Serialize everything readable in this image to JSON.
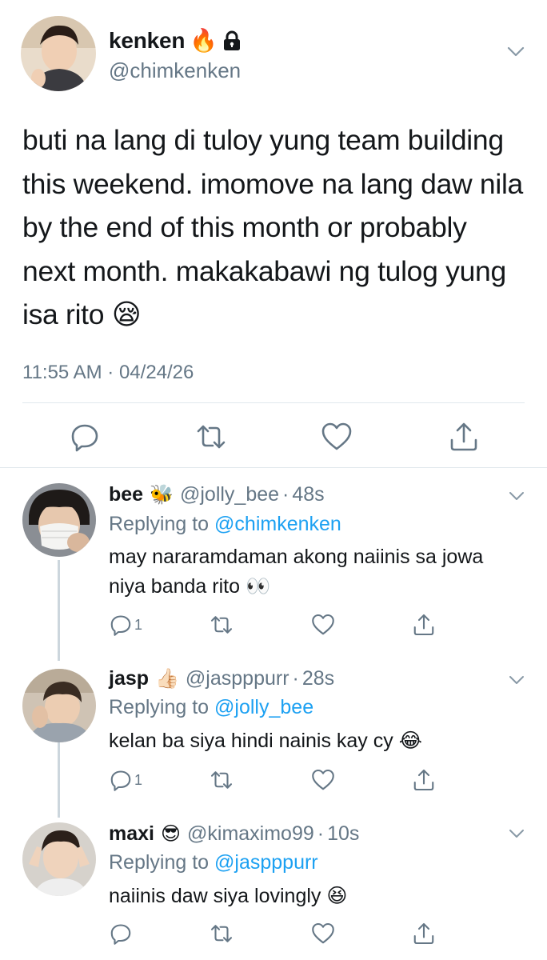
{
  "main_tweet": {
    "display_name": "kenken",
    "name_emoji": "🔥",
    "handle": "@chimkenken",
    "text": "buti na lang di tuloy yung team building this weekend. imomove na lang daw nila by the end of this month or probably next month. makakabawi ng tulog yung isa rito 😪",
    "timestamp": "11:55 AM · 04/24/26",
    "icons": [
      "reply-icon",
      "retweet-icon",
      "like-icon",
      "share-icon"
    ]
  },
  "replies": [
    {
      "display_name": "bee",
      "name_emoji": "🐝",
      "handle": "@jolly_bee",
      "separator": "·",
      "time": "48s",
      "replying_prefix": "Replying to",
      "replying_to": "@chimkenken",
      "text": "may nararamdaman akong naiinis sa jowa niya banda rito 👀",
      "reply_count": "1"
    },
    {
      "display_name": "jasp",
      "name_emoji": "👍🏻",
      "handle": "@jaspppurr",
      "separator": "·",
      "time": "28s",
      "replying_prefix": "Replying to",
      "replying_to": "@jolly_bee",
      "text": "kelan ba siya hindi nainis kay cy 😂",
      "reply_count": "1"
    },
    {
      "display_name": "maxi",
      "name_emoji": "😎",
      "handle": "@kimaximo99",
      "separator": "·",
      "time": "10s",
      "replying_prefix": "Replying to",
      "replying_to": "@jaspppurr",
      "text": "naiinis daw siya lovingly 😆",
      "reply_count": ""
    }
  ],
  "colors": {
    "text": "#14171a",
    "secondary": "#657786",
    "link": "#1da1f2",
    "divider": "#e1e8ed",
    "thread_line": "#ccd6dd"
  }
}
